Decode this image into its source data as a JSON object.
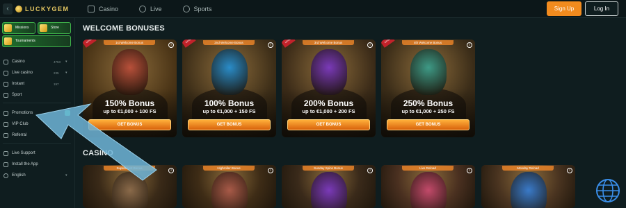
{
  "header": {
    "back_icon": "chevron-left-icon",
    "logo_text": "LUCKYGEM",
    "nav": [
      {
        "label": "Casino",
        "icon": "casino-icon"
      },
      {
        "label": "Live",
        "icon": "live-icon"
      },
      {
        "label": "Sports",
        "icon": "sports-icon"
      }
    ],
    "signup_label": "Sign Up",
    "login_label": "Log In",
    "signup_color": "#f28b1e"
  },
  "sidebar": {
    "tiles": [
      {
        "label": "Missions"
      },
      {
        "label": "Store"
      },
      {
        "label": "Tournaments"
      }
    ],
    "items": [
      {
        "label": "Casino",
        "count": "4753",
        "icon": "casino-icon",
        "chevron": true
      },
      {
        "label": "Live casino",
        "count": "235",
        "icon": "live-casino-icon",
        "chevron": true
      },
      {
        "label": "Instant",
        "count": "197",
        "icon": "instant-icon"
      },
      {
        "label": "Sport",
        "icon": "sport-icon"
      },
      {
        "label": "Promotions",
        "icon": "gift-icon",
        "badge": true
      },
      {
        "label": "VIP Club",
        "icon": "crown-icon"
      },
      {
        "label": "Referral",
        "icon": "referral-icon"
      },
      {
        "label": "Live Support",
        "icon": "support-icon"
      },
      {
        "label": "Install the App",
        "icon": "install-icon"
      },
      {
        "label": "English",
        "icon": "globe-icon",
        "chevron": true
      }
    ]
  },
  "main": {
    "welcome_title": "WELCOME BONUSES",
    "casino_title": "CASINO",
    "welcome_cards": [
      {
        "tag": "1st Welcome Bonus",
        "ribbon": "Limited",
        "big": "150% Bonus",
        "sub": "up to €1,000 + 100 FS",
        "button": "GET BONUS",
        "face_color": "#b8503a",
        "bg": "#4a3416"
      },
      {
        "tag": "2nd Welcome Bonus",
        "ribbon": "Limited",
        "big": "100% Bonus",
        "sub": "up to €1,000 + 150 FS",
        "button": "GET BONUS",
        "face_color": "#2a8cc8",
        "bg": "#3d2e18"
      },
      {
        "tag": "3rd Welcome Bonus",
        "ribbon": "Limited",
        "big": "200% Bonus",
        "sub": "up to €1,000 + 200 FS",
        "button": "GET BONUS",
        "face_color": "#7a3ab8",
        "bg": "#3b2b18"
      },
      {
        "tag": "4th Welcome Bonus",
        "ribbon": "Limited",
        "big": "250% Bonus",
        "sub": "up to €1,000 + 250 FS",
        "button": "GET BONUS",
        "face_color": "#3e9a86",
        "bg": "#3a2c18"
      }
    ],
    "casino_cards": [
      {
        "tag": "Superboost Bonus",
        "face_color": "#8a6a4a",
        "bg": "#3a2a18"
      },
      {
        "tag": "Highroller Bonus",
        "face_color": "#a85a48",
        "bg": "#3e2c16"
      },
      {
        "tag": "Sunday Spins Bonus",
        "face_color": "#7a3ab8",
        "bg": "#3a2a1a"
      },
      {
        "tag": "Live Reload",
        "face_color": "#c24a6a",
        "bg": "#4a3020"
      },
      {
        "tag": "Monday Reload",
        "face_color": "#3a7ac8",
        "bg": "#4a3420"
      }
    ]
  }
}
